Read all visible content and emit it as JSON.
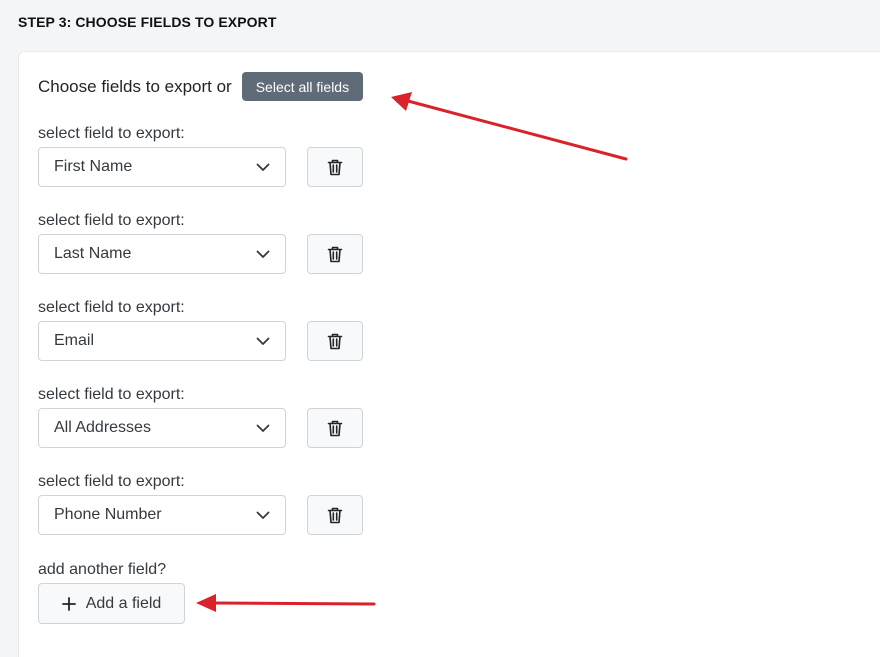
{
  "step_title": "STEP 3: CHOOSE FIELDS TO EXPORT",
  "intro": {
    "text": "Choose fields to export or",
    "select_all_label": "Select all fields"
  },
  "fields": [
    {
      "label": "select field to export:",
      "value": "First Name"
    },
    {
      "label": "select field to export:",
      "value": "Last Name"
    },
    {
      "label": "select field to export:",
      "value": "Email"
    },
    {
      "label": "select field to export:",
      "value": "All Addresses"
    },
    {
      "label": "select field to export:",
      "value": "Phone Number"
    }
  ],
  "add_field": {
    "label": "add another field?",
    "button_label": "Add a field"
  },
  "icons": {
    "dropdown": "chevron-down-icon",
    "delete": "trash-icon",
    "add": "plus-icon"
  },
  "colors": {
    "select_all_button": "#5f6b77",
    "annotation_arrow": "#d9232a"
  }
}
